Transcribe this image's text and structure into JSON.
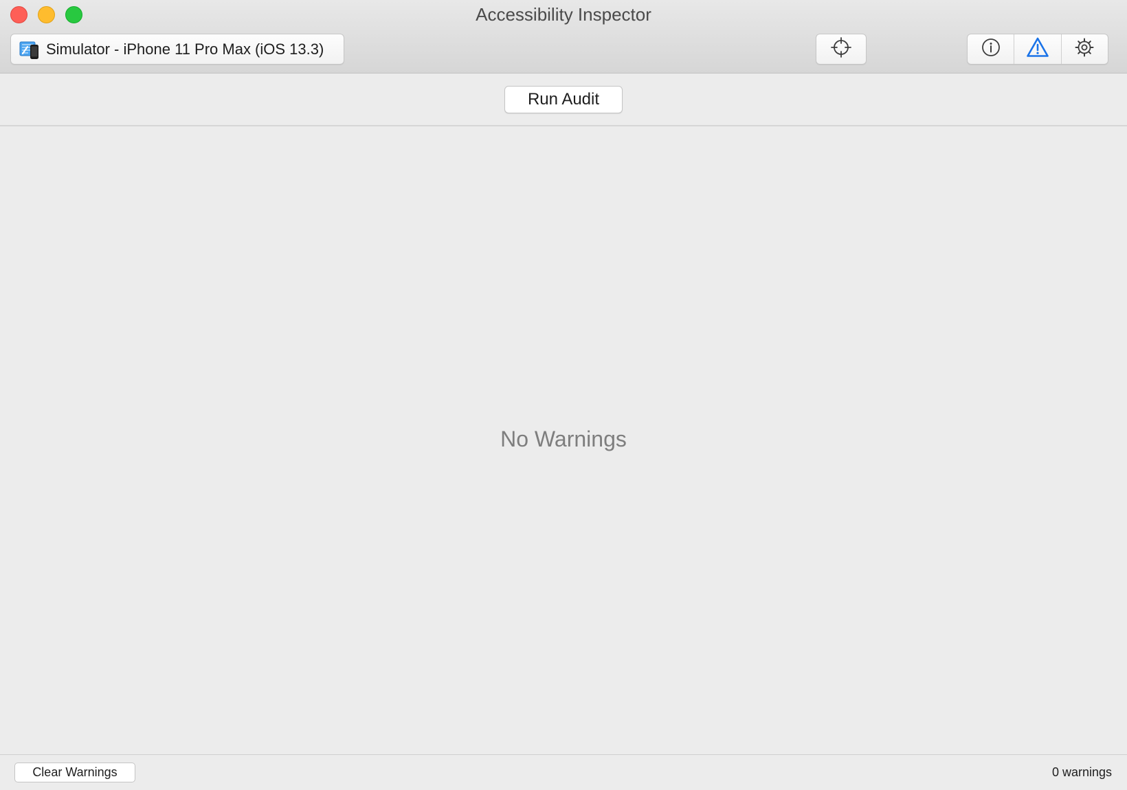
{
  "window": {
    "title": "Accessibility Inspector",
    "traffic_lights": [
      "close",
      "minimize",
      "zoom"
    ]
  },
  "toolbar": {
    "target": {
      "label": "Simulator - iPhone 11 Pro Max (iOS 13.3)",
      "icon": "simulator-app-icon"
    },
    "inspection_pointer": {
      "icon": "crosshair-icon"
    },
    "segments": [
      {
        "icon": "info-icon",
        "selected": false
      },
      {
        "icon": "warning-triangle-icon",
        "selected": true
      },
      {
        "icon": "gear-icon",
        "selected": false
      }
    ]
  },
  "audit": {
    "run_label": "Run Audit",
    "empty_message": "No Warnings"
  },
  "footer": {
    "clear_label": "Clear Warnings",
    "count_text": "0 warnings"
  },
  "colors": {
    "accent": "#1a73e8",
    "close": "#fe5f57",
    "minimize": "#febc2e",
    "zoom": "#28c840"
  }
}
